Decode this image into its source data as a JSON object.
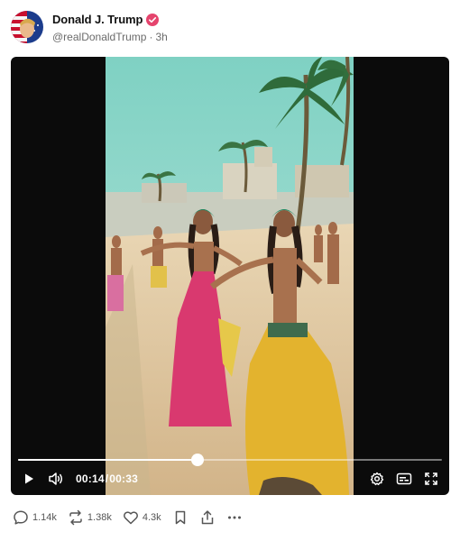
{
  "post": {
    "author_name": "Donald J. Trump",
    "handle": "@realDonaldTrump",
    "separator": "·",
    "time_ago": "3h"
  },
  "video": {
    "current_time": "00:14",
    "time_separator": "/",
    "duration": "00:33",
    "progress": 0.4242
  },
  "actions": {
    "replies": "1.14k",
    "reposts": "1.38k",
    "likes": "4.3k"
  },
  "icons": {
    "verified": "verified-badge-icon",
    "play": "play-icon",
    "volume": "volume-icon",
    "settings": "gear-icon",
    "captions": "captions-icon",
    "fullscreen": "fullscreen-icon",
    "reply": "reply-icon",
    "repost": "repost-icon",
    "like": "heart-icon",
    "bookmark": "bookmark-icon",
    "share": "share-icon",
    "more": "more-icon"
  },
  "colors": {
    "verified_badge": "#e5446d",
    "video_background": "#0b0b0b",
    "muted_text": "#6b6b6b"
  }
}
